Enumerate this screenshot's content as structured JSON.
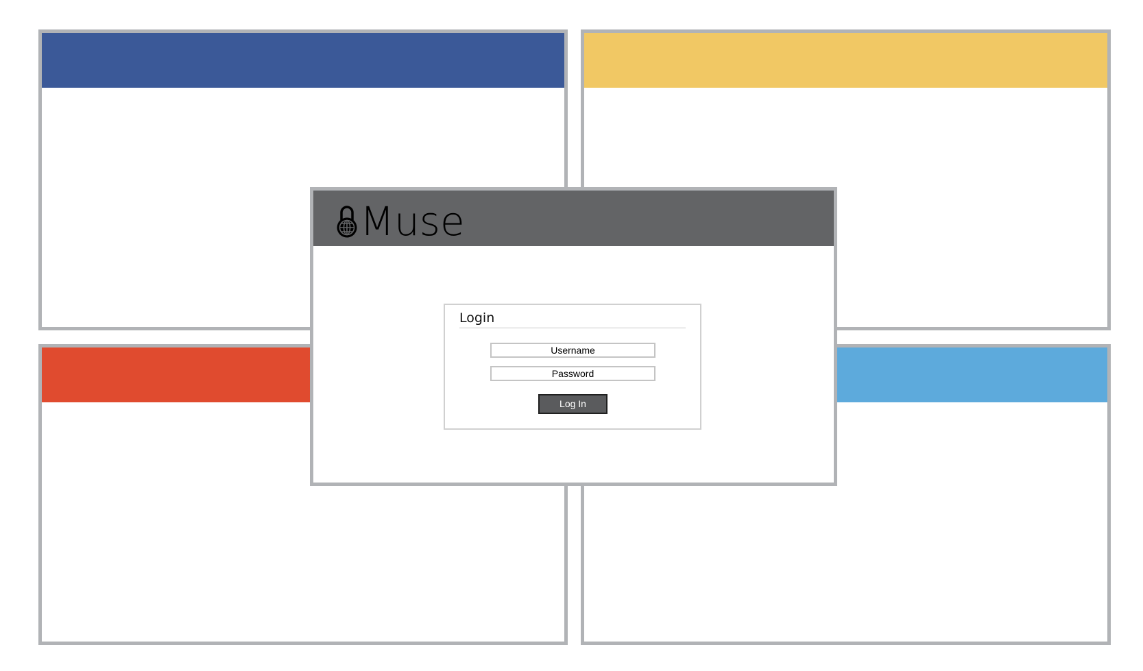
{
  "colors": {
    "window_border": "#b1b3b6",
    "tile_blue": "#3b5998",
    "tile_yellow": "#f1c864",
    "tile_red": "#e04b2f",
    "tile_lightblue": "#5daadc",
    "header_gray": "#636466",
    "button_gray": "#5a5b5d"
  },
  "app": {
    "name": "Muse",
    "logo_icon": "lock-globe-icon"
  },
  "login": {
    "title": "Login",
    "username_placeholder": "Username",
    "password_placeholder": "Password",
    "submit_label": "Log In"
  }
}
